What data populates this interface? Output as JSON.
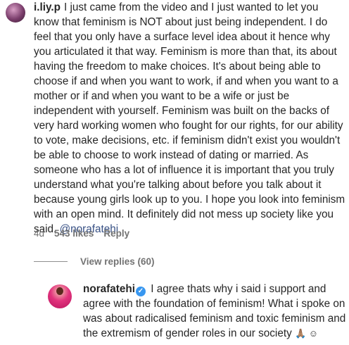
{
  "comment1": {
    "username": "i.liy.p",
    "text": "I just came from the video and I just wanted to let you know that feminism is NOT about just being independent. I do feel that you only have a surface level idea about it hence why you articulated it that way. Feminism is more than that, its about having the freedom to make choices. It's about being able to choose if and when you want to work, if and when you want to a mother or if and when you want to be a wife or just be independent with yourself. Feminism was built on the backs of very hard working women who fought for our rights, for our ability to vote, make decisions, etc. if feminism didn't exist you wouldn't be able to choose to work instead of dating or married. As someone who has a lot of influence it is important that you truly understand what you're talking about before you talk about it because young girls look up to you. I hope you look into feminism with an open mind. It definitely did not mess up society like you said.",
    "mention": "@norafatehi",
    "age": "4d",
    "likes": "543 likes",
    "reply_label": "Reply"
  },
  "replies": {
    "view_label": "View replies (60)"
  },
  "comment2": {
    "username": "norafatehi",
    "verified_glyph": "✓",
    "text": "I agree thats why i said i support and agree with the foundation of feminism! What i spoke on was about radicalised feminism and toxic feminism and the extremism of gender roles in our society",
    "emojis": "🙏🏽 ☺"
  },
  "colors": {
    "text": "#262626",
    "muted": "#737373",
    "mention": "#385185",
    "verified": "#3897f0"
  }
}
